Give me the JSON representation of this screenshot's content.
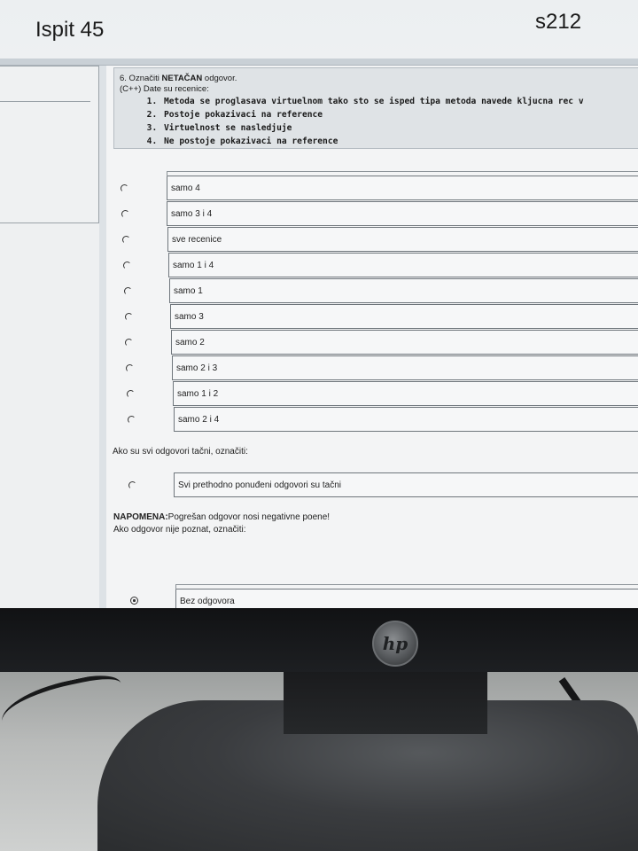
{
  "banner": {
    "left": "Ispit 45",
    "right": "s212"
  },
  "question": {
    "number_prefix": "6. Označiti ",
    "number_emph": "NETAČAN",
    "number_suffix": " odgovor.",
    "context": "(C++) Date su recenice:",
    "statements": [
      "Metoda se proglasava virtuelnom tako sto se isped tipa metoda navede kljucna rec v",
      "Postoje pokazivaci na reference",
      "Virtuelnost se nasledjuje",
      "Ne postoje pokazivaci na reference"
    ]
  },
  "options": [
    "samo 4",
    "samo 3 i 4",
    "sve recenice",
    "samo 1 i 4",
    "samo 1",
    "samo 3",
    "samo 2",
    "samo 2 i 3",
    "samo 1 i 2",
    "samo 2 i 4"
  ],
  "all_correct": {
    "prompt": "Ako su svi odgovori tačni, označiti:",
    "option": "Svi prethodno ponuđeni odgovori su tačni"
  },
  "note": {
    "label": "NAPOMENA:",
    "text": "Pogrešan odgovor nosi negativne poene!",
    "unknown_prompt": "Ako odgovor nije poznat, označiti:"
  },
  "no_answer": {
    "option": "Bez odgovora",
    "selected": true
  },
  "monitor": {
    "brand": "hp"
  }
}
